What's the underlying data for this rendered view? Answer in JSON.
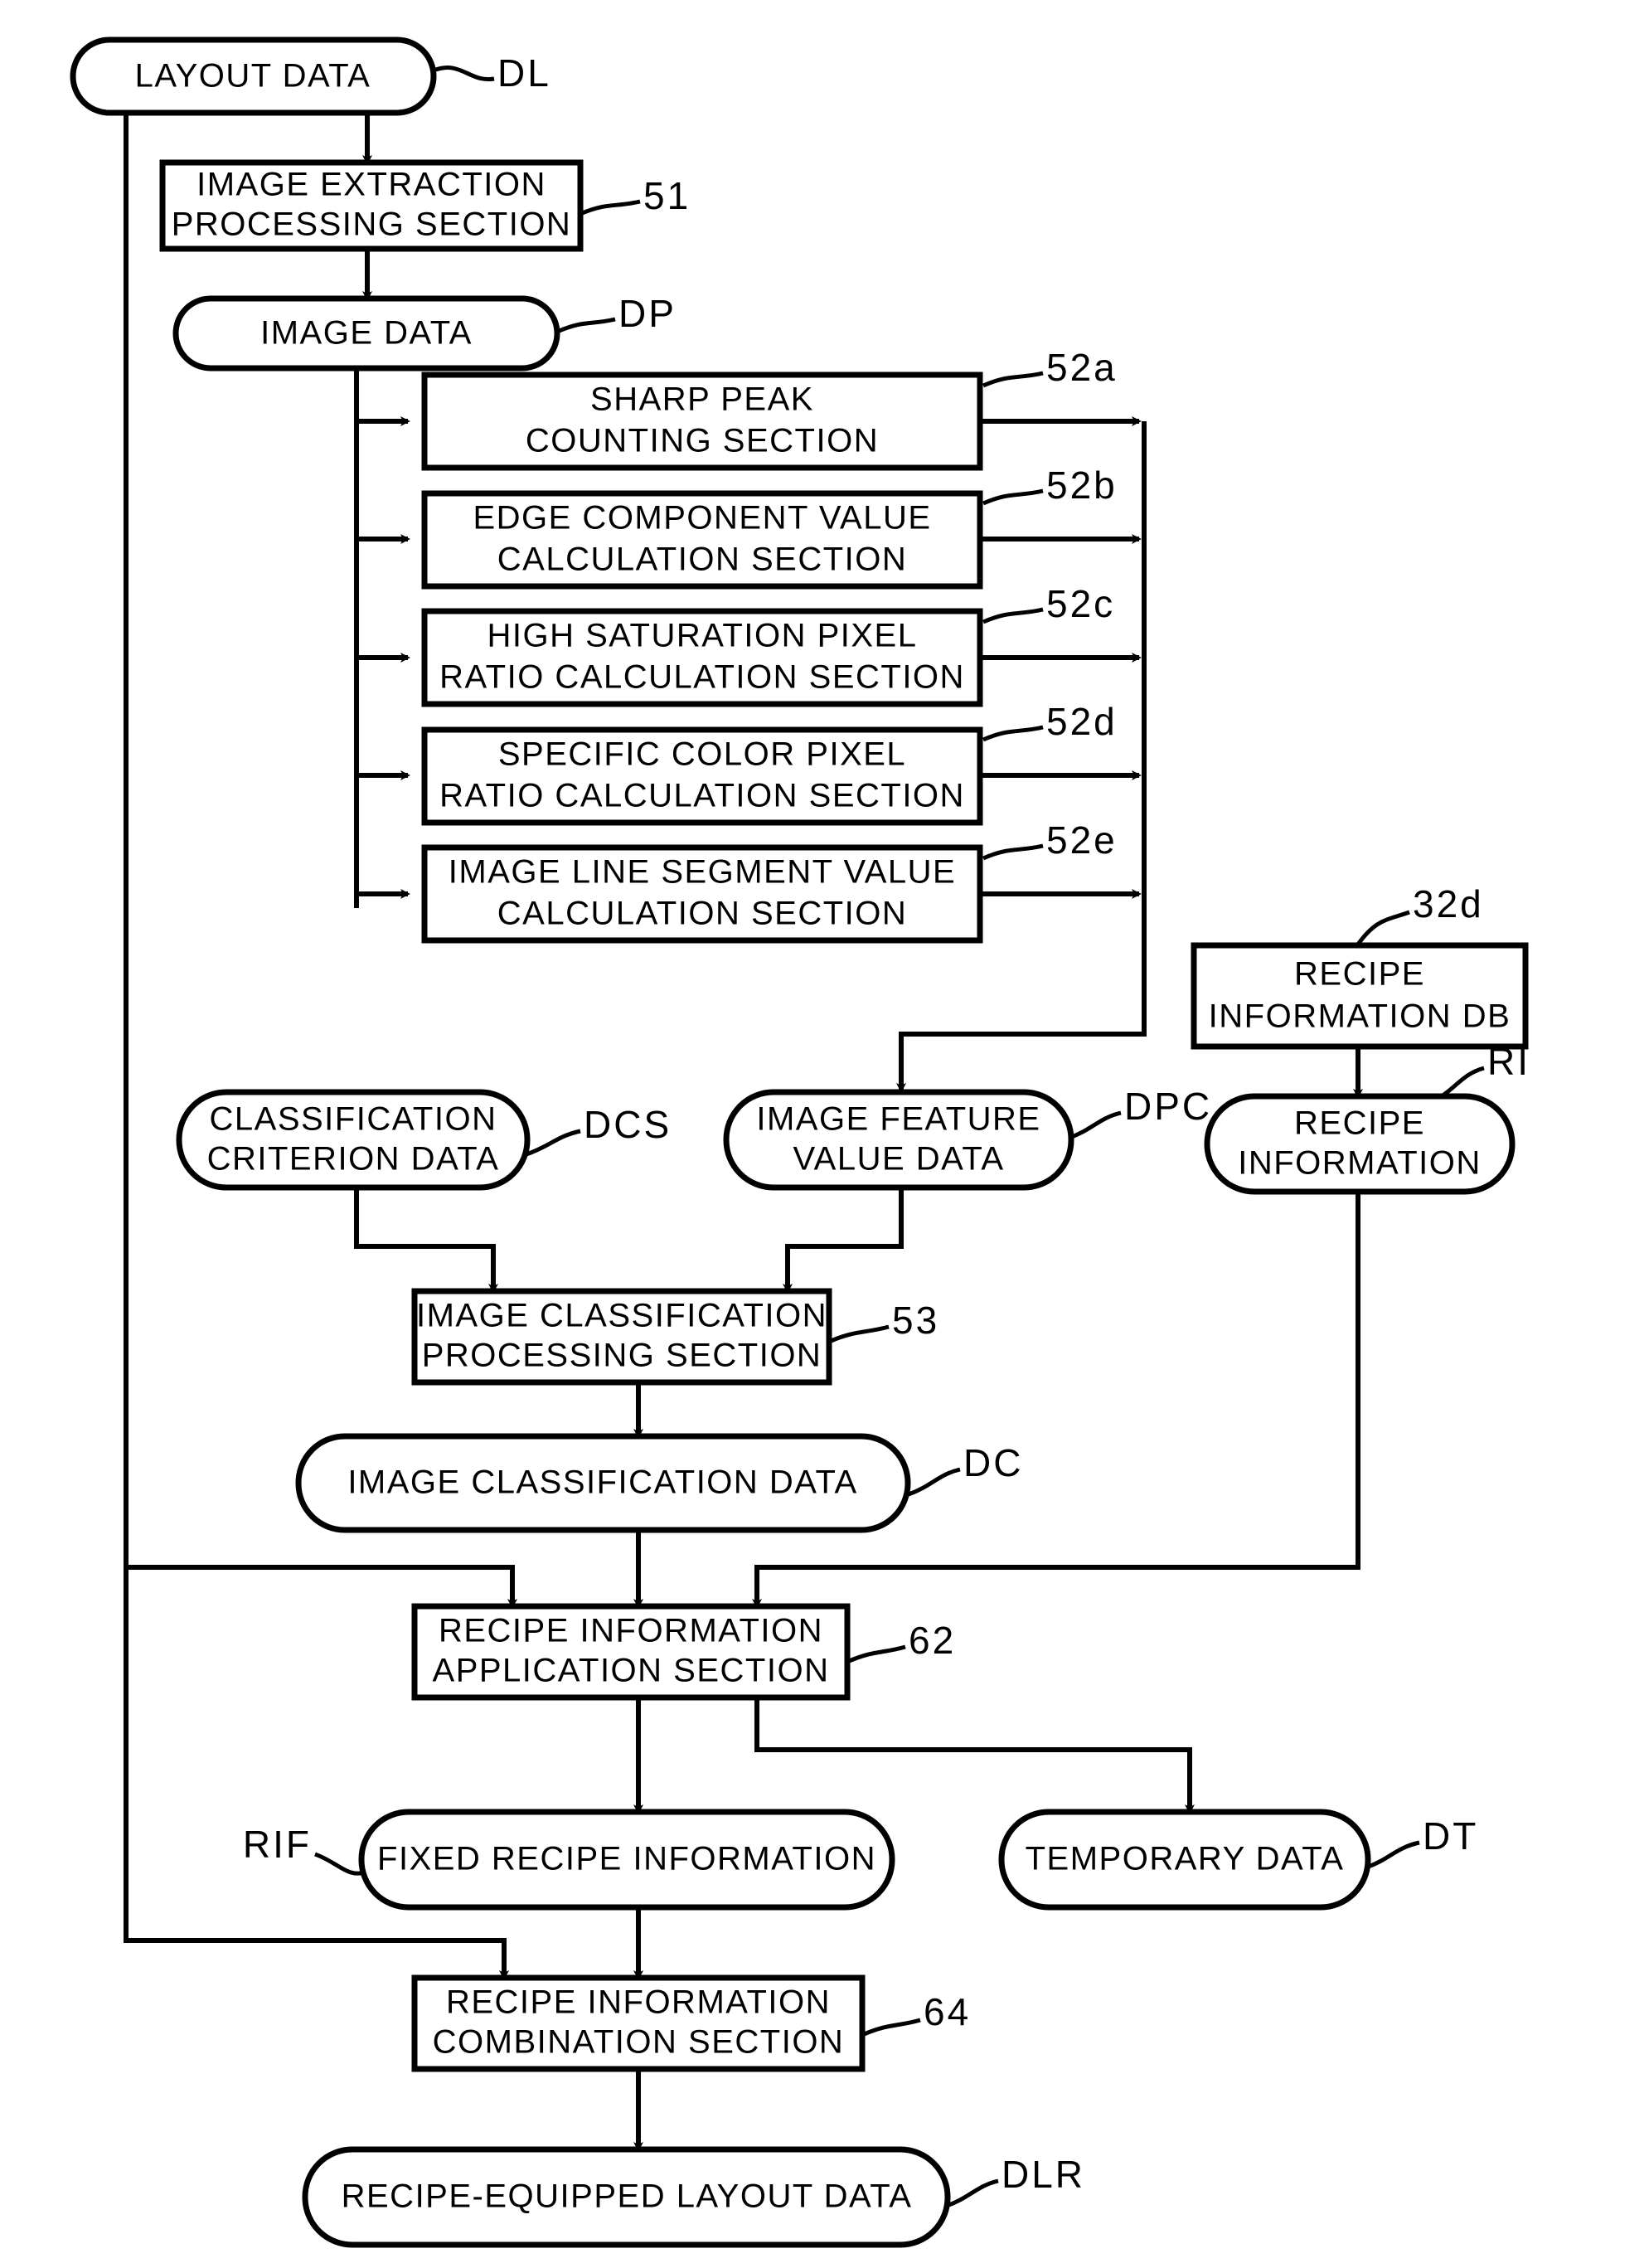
{
  "figure": {
    "title": "Image processing recipe flow diagram",
    "line_color": "#000000",
    "background_color": "#ffffff"
  },
  "nodes": {
    "layout_data": {
      "label": "LAYOUT DATA",
      "ref": "DL",
      "shape": "terminator"
    },
    "image_extraction": {
      "line1": "IMAGE EXTRACTION",
      "line2": "PROCESSING SECTION",
      "ref": "51",
      "shape": "process"
    },
    "image_data": {
      "label": "IMAGE DATA",
      "ref": "DP",
      "shape": "terminator"
    },
    "sharp_peak": {
      "line1": "SHARP PEAK",
      "line2": "COUNTING SECTION",
      "ref": "52a",
      "shape": "process"
    },
    "edge_component": {
      "line1": "EDGE COMPONENT VALUE",
      "line2": "CALCULATION SECTION",
      "ref": "52b",
      "shape": "process"
    },
    "high_saturation": {
      "line1": "HIGH SATURATION PIXEL",
      "line2": "RATIO CALCULATION SECTION",
      "ref": "52c",
      "shape": "process"
    },
    "specific_color": {
      "line1": "SPECIFIC COLOR PIXEL",
      "line2": "RATIO CALCULATION SECTION",
      "ref": "52d",
      "shape": "process"
    },
    "image_line_segment": {
      "line1": "IMAGE LINE SEGMENT VALUE",
      "line2": "CALCULATION SECTION",
      "ref": "52e",
      "shape": "process"
    },
    "recipe_information_db": {
      "line1": "RECIPE",
      "line2": "INFORMATION DB",
      "ref": "32d",
      "shape": "process"
    },
    "recipe_information": {
      "line1": "RECIPE",
      "line2": "INFORMATION",
      "ref": "RI",
      "shape": "terminator"
    },
    "classification_criterion": {
      "line1": "CLASSIFICATION",
      "line2": "CRITERION DATA",
      "ref": "DCS",
      "shape": "terminator"
    },
    "image_feature_value": {
      "line1": "IMAGE FEATURE",
      "line2": "VALUE DATA",
      "ref": "DPC",
      "shape": "terminator"
    },
    "image_classification_proc": {
      "line1": "IMAGE CLASSIFICATION",
      "line2": "PROCESSING SECTION",
      "ref": "53",
      "shape": "process"
    },
    "image_classification_data": {
      "label": "IMAGE CLASSIFICATION DATA",
      "ref": "DC",
      "shape": "terminator"
    },
    "recipe_info_application": {
      "line1": "RECIPE INFORMATION",
      "line2": "APPLICATION SECTION",
      "ref": "62",
      "shape": "process"
    },
    "fixed_recipe_information": {
      "label": "FIXED RECIPE INFORMATION",
      "ref": "RIF",
      "shape": "terminator"
    },
    "temporary_data": {
      "label": "TEMPORARY DATA",
      "ref": "DT",
      "shape": "terminator"
    },
    "recipe_info_combination": {
      "line1": "RECIPE INFORMATION",
      "line2": "COMBINATION SECTION",
      "ref": "64",
      "shape": "process"
    },
    "recipe_equipped_layout": {
      "label": "RECIPE-EQUIPPED LAYOUT DATA",
      "ref": "DLR",
      "shape": "terminator"
    }
  }
}
